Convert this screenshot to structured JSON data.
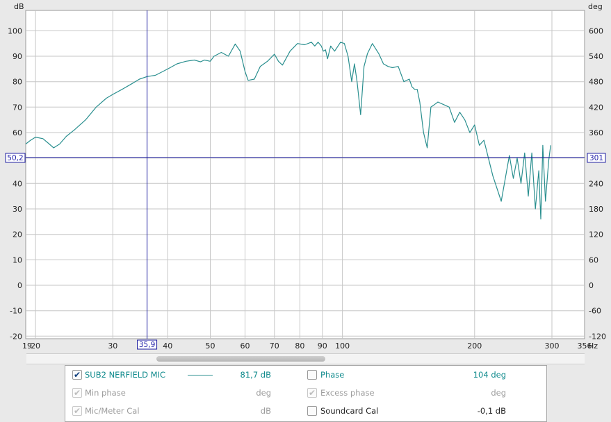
{
  "chart_data": {
    "type": "line",
    "title": "",
    "xlabel": "Hz",
    "ylabel": "dB",
    "y2label": "deg",
    "xscale": "log",
    "xlim": [
      19,
      356
    ],
    "ylim": [
      -21,
      108
    ],
    "y2lim": [
      -126,
      648
    ],
    "grid": true,
    "x_ticks": [
      "19",
      "20",
      "30",
      "40",
      "50",
      "60",
      "70",
      "80",
      "90",
      "100",
      "200",
      "300",
      "356"
    ],
    "x_tick_values": [
      19,
      20,
      30,
      40,
      50,
      60,
      70,
      80,
      90,
      100,
      200,
      300,
      356
    ],
    "y_ticks": [
      100,
      90,
      80,
      70,
      60,
      50,
      40,
      30,
      20,
      10,
      0,
      -10,
      -20
    ],
    "y2_ticks": [
      600,
      540,
      480,
      420,
      360,
      300,
      240,
      180,
      120,
      60,
      0,
      -60,
      -120
    ],
    "series": [
      {
        "name": "SUB2 NERFIELD MIC",
        "color": "#2a8f8f",
        "x": [
          19,
          19.5,
          20,
          20.8,
          21.5,
          22,
          22.7,
          23.5,
          24.5,
          26,
          27.5,
          29,
          30,
          31.5,
          33,
          34.5,
          35.9,
          37.5,
          39,
          40.5,
          42,
          44,
          46,
          47.5,
          48.5,
          50,
          51,
          53,
          55,
          57,
          58.5,
          60,
          61,
          63,
          65,
          67.5,
          70,
          71.5,
          73,
          76,
          79,
          82,
          85,
          86.5,
          88,
          89.5,
          90.5,
          91.5,
          92.5,
          94,
          96,
          99,
          101,
          103,
          105,
          106.5,
          108,
          110,
          112,
          114,
          117,
          121,
          124,
          127,
          130,
          134,
          138,
          142,
          144,
          146,
          148,
          150,
          153,
          156,
          159,
          162,
          165,
          170,
          175,
          180,
          185,
          190,
          195,
          200,
          205,
          210,
          220,
          230,
          240,
          245,
          250,
          255,
          260,
          265,
          270,
          275,
          280,
          283,
          286,
          290,
          295,
          298
        ],
        "y": [
          55.5,
          57,
          58.2,
          57.6,
          55.5,
          54,
          55.5,
          58.5,
          61,
          65,
          70,
          73.5,
          75,
          77,
          79,
          81,
          82,
          82.5,
          84,
          85.5,
          87,
          88,
          88.5,
          87.8,
          88.5,
          88,
          90,
          91.5,
          90,
          94.8,
          92,
          84,
          80.5,
          81,
          86,
          88,
          90.8,
          88,
          86.5,
          92,
          95,
          94.5,
          95.5,
          94,
          95.5,
          94,
          92,
          92.5,
          89,
          94,
          92,
          95.5,
          95,
          90,
          80,
          87,
          80,
          67,
          86,
          91,
          95,
          91,
          87,
          86,
          85.5,
          86,
          80,
          81,
          78,
          77,
          77,
          72,
          60,
          54,
          70,
          71,
          72,
          71,
          70,
          64,
          68,
          65,
          60,
          63,
          55,
          57,
          43,
          33,
          51,
          42,
          50,
          40,
          52,
          35,
          52,
          30,
          45,
          26,
          55,
          33,
          49,
          55
        ]
      }
    ],
    "cursor": {
      "x_label": "35,9",
      "y_label": "50,2",
      "y2_label": "301"
    }
  },
  "legend": {
    "rows": [
      {
        "checked": true,
        "label": "SUB2 NERFIELD MIC",
        "value": "81,7 dB",
        "style": "teal",
        "swatch": true
      },
      {
        "checked": true,
        "disabled": true,
        "label": "Min phase",
        "value": "deg",
        "style": "grey"
      },
      {
        "checked": true,
        "disabled": true,
        "label": "Mic/Meter Cal",
        "value": "dB",
        "style": "grey"
      }
    ],
    "rows_right": [
      {
        "checked": false,
        "label": "Phase",
        "value": "104 deg",
        "style": "teal"
      },
      {
        "checked": true,
        "disabled": true,
        "label": "Excess phase",
        "value": "deg",
        "style": "grey"
      },
      {
        "checked": false,
        "label": "Soundcard Cal",
        "value": "-0,1 dB",
        "style": "dark"
      }
    ]
  },
  "colors": {
    "plot_bg": "#ffffff",
    "grid": "#c6c6c6",
    "trace": "#2a8f8f",
    "cursor": "#1a1aa0"
  }
}
